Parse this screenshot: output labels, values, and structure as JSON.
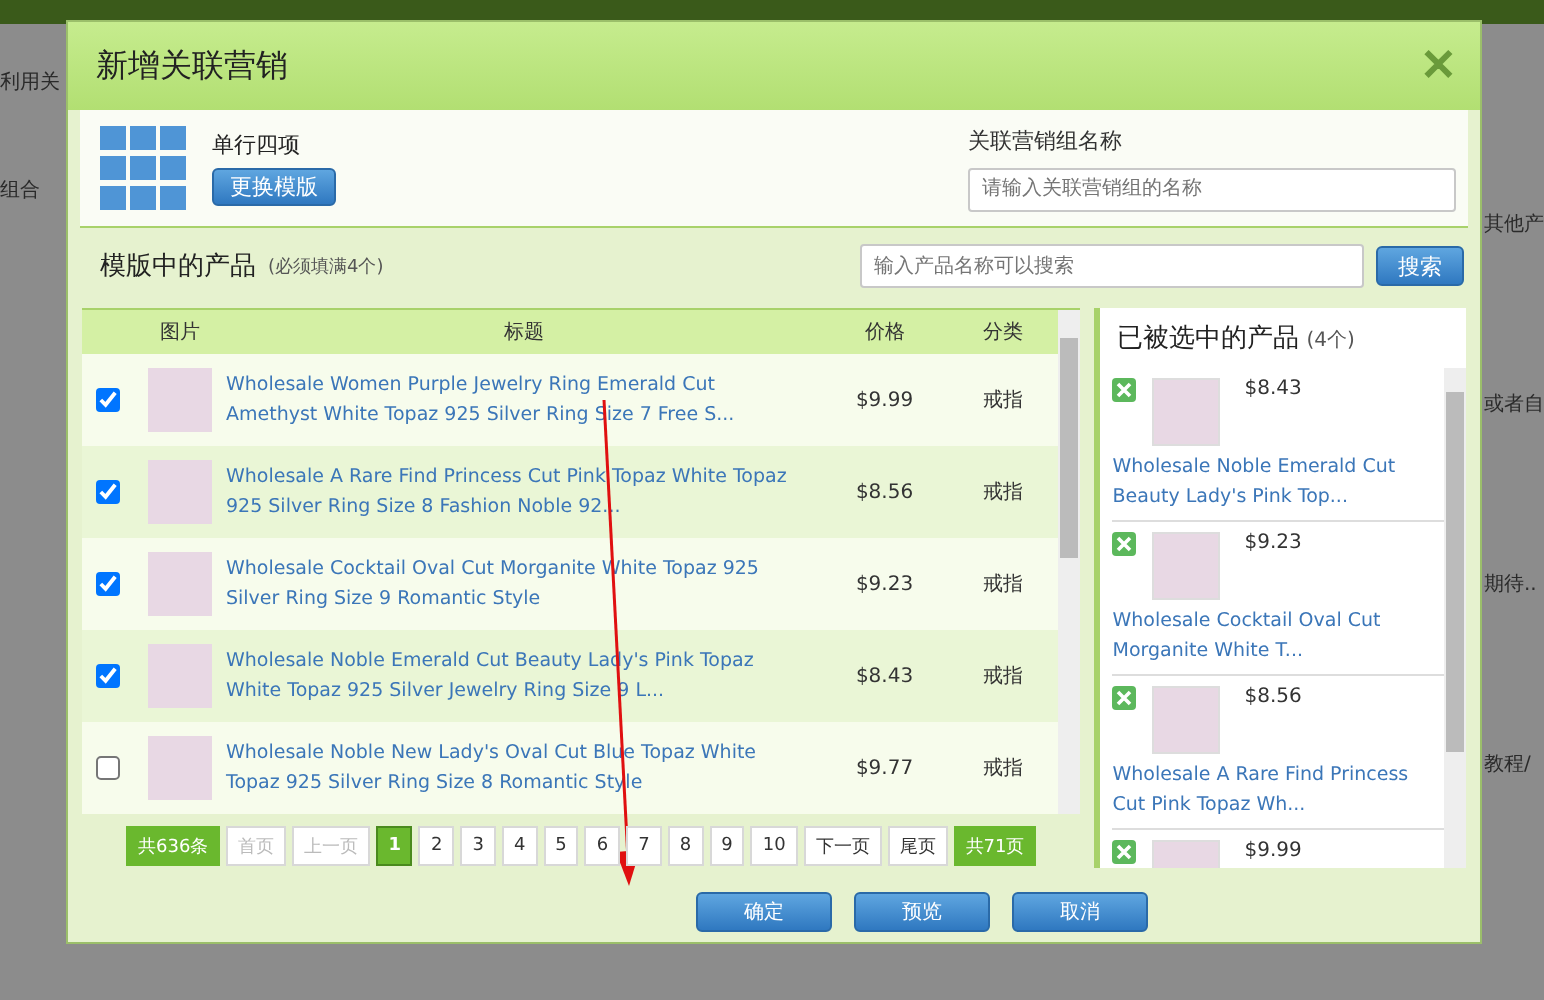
{
  "background_page": {
    "left_texts": [
      "利用关",
      "组合"
    ],
    "right_texts": [
      "其他产",
      "或者自",
      "期待..",
      "教程/"
    ]
  },
  "dialog": {
    "title": "新增关联营销",
    "close": "✕",
    "template": {
      "name": "单行四项",
      "button": "更换模版"
    },
    "group_name": {
      "label": "关联营销组名称",
      "placeholder": "请输入关联营销组的名称"
    },
    "products_section": {
      "title": "模版中的产品",
      "hint": "(必须填满4个)",
      "search_placeholder": "输入产品名称可以搜索",
      "search_button": "搜索"
    },
    "table": {
      "columns": [
        "图片",
        "标题",
        "价格",
        "分类"
      ],
      "rows": [
        {
          "checked": true,
          "title": "Wholesale Women Purple Jewelry Ring Emerald Cut Amethyst White Topaz 925 Silver Ring Size 7 Free S...",
          "price": "$9.99",
          "category": "戒指"
        },
        {
          "checked": true,
          "title": "Wholesale A Rare Find Princess Cut Pink Topaz White Topaz 925 Silver Ring Size 8 Fashion Noble 92...",
          "price": "$8.56",
          "category": "戒指"
        },
        {
          "checked": true,
          "title": "Wholesale Cocktail Oval Cut Morganite White Topaz 925 Silver Ring Size 9 Romantic Style",
          "price": "$9.23",
          "category": "戒指"
        },
        {
          "checked": true,
          "title": "Wholesale Noble Emerald Cut Beauty Lady's Pink Topaz White Topaz 925 Silver Jewelry Ring Size 9 L...",
          "price": "$8.43",
          "category": "戒指"
        },
        {
          "checked": false,
          "title": "Wholesale Noble New Lady's Oval Cut Blue Topaz White Topaz 925 Silver Ring Size 8 Romantic Style",
          "price": "$9.77",
          "category": "戒指"
        }
      ]
    },
    "pagination": [
      {
        "kind": "info",
        "label": "共636条",
        "selected": false,
        "disabled": false
      },
      {
        "kind": "nav",
        "label": "首页",
        "selected": false,
        "disabled": true
      },
      {
        "kind": "nav",
        "label": "上一页",
        "selected": false,
        "disabled": true
      },
      {
        "kind": "page",
        "label": "1",
        "selected": true,
        "disabled": false
      },
      {
        "kind": "page",
        "label": "2",
        "selected": false,
        "disabled": false
      },
      {
        "kind": "page",
        "label": "3",
        "selected": false,
        "disabled": false
      },
      {
        "kind": "page",
        "label": "4",
        "selected": false,
        "disabled": false
      },
      {
        "kind": "page",
        "label": "5",
        "selected": false,
        "disabled": false
      },
      {
        "kind": "page",
        "label": "6",
        "selected": false,
        "disabled": false
      },
      {
        "kind": "page",
        "label": "7",
        "selected": false,
        "disabled": false
      },
      {
        "kind": "page",
        "label": "8",
        "selected": false,
        "disabled": false
      },
      {
        "kind": "page",
        "label": "9",
        "selected": false,
        "disabled": false
      },
      {
        "kind": "page",
        "label": "10",
        "selected": false,
        "disabled": false
      },
      {
        "kind": "nav",
        "label": "下一页",
        "selected": false,
        "disabled": false
      },
      {
        "kind": "nav",
        "label": "尾页",
        "selected": false,
        "disabled": false
      },
      {
        "kind": "info",
        "label": "共71页",
        "selected": false,
        "disabled": false
      }
    ],
    "selected_panel": {
      "title": "已被选中的产品",
      "count": "(4个)",
      "items": [
        {
          "price": "$8.43",
          "title": "Wholesale Noble Emerald Cut Beauty Lady's Pink Top..."
        },
        {
          "price": "$9.23",
          "title": "Wholesale Cocktail Oval Cut Morganite White T..."
        },
        {
          "price": "$8.56",
          "title": "Wholesale A Rare Find Princess Cut Pink Topaz Wh..."
        },
        {
          "price": "$9.99"
        }
      ]
    },
    "buttons": [
      "确定",
      "预览",
      "取消"
    ]
  }
}
